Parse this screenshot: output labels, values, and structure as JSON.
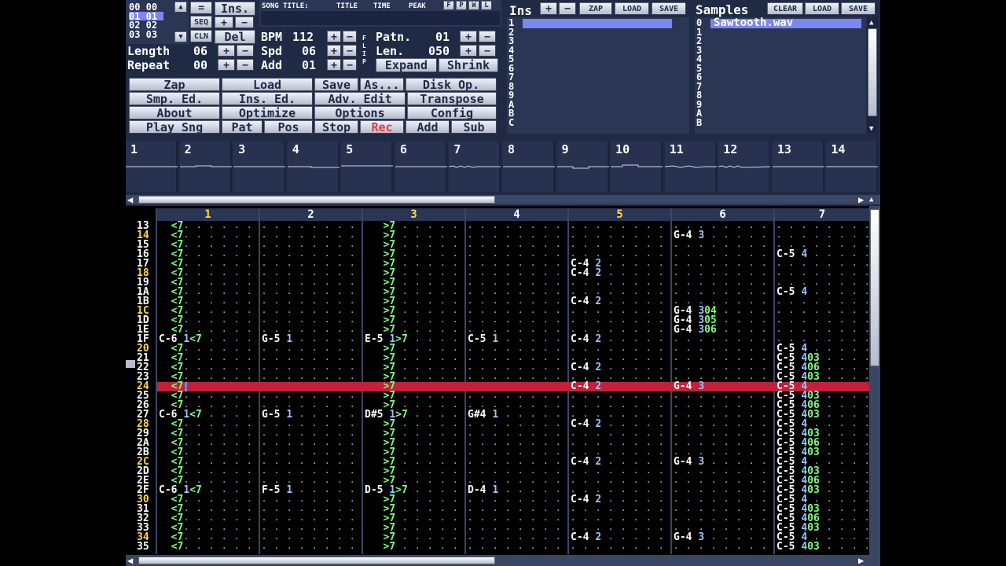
{
  "song": {
    "positions": [
      "00 00",
      "01 01",
      "02 02",
      "03 03"
    ],
    "length_label": "Length",
    "length": "06",
    "repeat_label": "Repeat",
    "repeat": "00"
  },
  "small_buttons": {
    "eq": "=",
    "seq": "SEQ",
    "cln": "CLN",
    "ins": "Ins.",
    "del": "Del",
    "plus": "+",
    "minus": "−"
  },
  "tempo": {
    "bpm_label": "BPM",
    "bpm": "112",
    "spd_label": "Spd",
    "spd": "06",
    "add_label": "Add",
    "add": "01",
    "flip": "FLIP"
  },
  "pattern_info": {
    "patn_label": "Patn.",
    "patn": "01",
    "len_label": "Len.",
    "len": "050",
    "expand": "Expand",
    "shrink": "Shrink"
  },
  "song_title": {
    "label": "SONG TITLE:",
    "title": "TITLE",
    "time": "TIME",
    "peak": "PEAK",
    "f": "F",
    "p": "P",
    "w": "W",
    "l": "L"
  },
  "menu": [
    [
      "Zap",
      "Load",
      "Save",
      "As...",
      "Disk Op."
    ],
    [
      "Smp. Ed.",
      "Ins. Ed.",
      "Adv. Edit",
      "Transpose"
    ],
    [
      "About",
      "Optimize",
      "Options",
      "Config"
    ],
    [
      "Play Sng",
      "Pat",
      "Pos",
      "Stop",
      "Rec",
      "Add",
      "Sub"
    ]
  ],
  "instruments": {
    "title": "Ins",
    "zap": "ZAP",
    "load": "LOAD",
    "save": "SAVE",
    "plus": "+",
    "minus": "−",
    "rows": [
      "1",
      "2",
      "3",
      "4",
      "5",
      "6",
      "7",
      "8",
      "9",
      "A",
      "B",
      "C"
    ]
  },
  "samples": {
    "title": "Samples",
    "clear": "CLEAR",
    "load": "LOAD",
    "save": "SAVE",
    "selected": "Sawtooth.wav",
    "rows": [
      "0",
      "1",
      "2",
      "3",
      "4",
      "5",
      "6",
      "7",
      "8",
      "9",
      "A",
      "B"
    ]
  },
  "scopes": [
    "1",
    "2",
    "3",
    "4",
    "5",
    "6",
    "7",
    "8",
    "9",
    "10",
    "11",
    "12",
    "13",
    "14"
  ],
  "channels": [
    "1",
    "2",
    "3",
    "4",
    "5",
    "6",
    "7"
  ],
  "active_channels": [
    "1",
    "3",
    "5"
  ],
  "rows": [
    {
      "n": "13",
      "c": [
        "  <7",
        "",
        "   >7",
        "",
        "",
        "",
        "",
        ""
      ]
    },
    {
      "n": "14",
      "hi": true,
      "c": [
        "  <7",
        "",
        "   >7",
        "",
        "",
        "G-4 3",
        "",
        ""
      ]
    },
    {
      "n": "15",
      "c": [
        "  <7",
        "",
        "   >7",
        "",
        "",
        "",
        "",
        ""
      ]
    },
    {
      "n": "16",
      "c": [
        "  <7",
        "",
        "   >7",
        "",
        "",
        "",
        "C-5 4",
        ""
      ]
    },
    {
      "n": "17",
      "c": [
        "  <7",
        "",
        "   >7",
        "",
        "C-4 2",
        "",
        "",
        ""
      ]
    },
    {
      "n": "18",
      "hi": true,
      "c": [
        "  <7",
        "",
        "   >7",
        "",
        "C-4 2",
        "",
        "",
        ""
      ]
    },
    {
      "n": "19",
      "c": [
        "  <7",
        "",
        "   >7",
        "",
        "",
        "",
        "",
        ""
      ]
    },
    {
      "n": "1A",
      "c": [
        "  <7",
        "",
        "   >7",
        "",
        "",
        "",
        "C-5 4",
        ""
      ]
    },
    {
      "n": "1B",
      "c": [
        "  <7",
        "",
        "   >7",
        "",
        "C-4 2",
        "",
        "",
        ""
      ]
    },
    {
      "n": "1C",
      "hi": true,
      "c": [
        "  <7",
        "",
        "   >7",
        "",
        "",
        "G-4 304",
        "",
        ""
      ]
    },
    {
      "n": "1D",
      "c": [
        "  <7",
        "",
        "   >7",
        "",
        "",
        "G-4 305",
        "",
        ""
      ]
    },
    {
      "n": "1E",
      "c": [
        "  <7",
        "",
        "   >7",
        "",
        "",
        "G-4 306",
        "",
        ""
      ]
    },
    {
      "n": "1F",
      "c": [
        "C-6 1<7",
        "G-5 1",
        "E-5 1>7",
        "C-5 1",
        "C-4 2",
        "",
        "",
        ""
      ]
    },
    {
      "n": "20",
      "hi": true,
      "c": [
        "  <7",
        "",
        "   >7",
        "",
        "",
        "",
        "C-5 4",
        ""
      ]
    },
    {
      "n": "21",
      "c": [
        "  <7",
        "",
        "   >7",
        "",
        "",
        "",
        "C-5 403",
        ""
      ]
    },
    {
      "n": "22",
      "c": [
        "  <7",
        "",
        "   >7",
        "",
        "C-4 2",
        "",
        "C-5 406",
        ""
      ]
    },
    {
      "n": "23",
      "c": [
        "  <7",
        "",
        "   >7",
        "",
        "",
        "",
        "C-5 403",
        ""
      ]
    },
    {
      "n": "24",
      "hi": true,
      "cur": true,
      "c": [
        "  <7",
        "",
        "   >7",
        "",
        "C-4 2",
        "G-4 3",
        "C-5 4",
        ""
      ]
    },
    {
      "n": "25",
      "c": [
        "  <7",
        "",
        "   >7",
        "",
        "",
        "",
        "C-5 403",
        ""
      ]
    },
    {
      "n": "26",
      "c": [
        "  <7",
        "",
        "   >7",
        "",
        "",
        "",
        "C-5 406",
        ""
      ]
    },
    {
      "n": "27",
      "c": [
        "C-6 1<7",
        "G-5 1",
        "D#5 1>7",
        "G#4 1",
        "",
        "",
        "C-5 403",
        ""
      ]
    },
    {
      "n": "28",
      "hi": true,
      "c": [
        "  <7",
        "",
        "   >7",
        "",
        "C-4 2",
        "",
        "C-5 4",
        ""
      ]
    },
    {
      "n": "29",
      "c": [
        "  <7",
        "",
        "   >7",
        "",
        "",
        "",
        "C-5 403",
        ""
      ]
    },
    {
      "n": "2A",
      "c": [
        "  <7",
        "",
        "   >7",
        "",
        "",
        "",
        "C-5 406",
        ""
      ]
    },
    {
      "n": "2B",
      "c": [
        "  <7",
        "",
        "   >7",
        "",
        "",
        "",
        "C-5 403",
        ""
      ]
    },
    {
      "n": "2C",
      "hi": true,
      "c": [
        "  <7",
        "",
        "   >7",
        "",
        "C-4 2",
        "G-4 3",
        "C-5 4",
        ""
      ]
    },
    {
      "n": "2D",
      "c": [
        "  <7",
        "",
        "   >7",
        "",
        "",
        "",
        "C-5 403",
        ""
      ]
    },
    {
      "n": "2E",
      "c": [
        "  <7",
        "",
        "   >7",
        "",
        "",
        "",
        "C-5 406",
        ""
      ]
    },
    {
      "n": "2F",
      "c": [
        "C-6 1<7",
        "F-5 1",
        "D-5 1>7",
        "D-4 1",
        "",
        "",
        "C-5 403",
        ""
      ]
    },
    {
      "n": "30",
      "hi": true,
      "c": [
        "  <7",
        "",
        "   >7",
        "",
        "C-4 2",
        "",
        "C-5 4",
        ""
      ]
    },
    {
      "n": "31",
      "c": [
        "  <7",
        "",
        "   >7",
        "",
        "",
        "",
        "C-5 403",
        ""
      ]
    },
    {
      "n": "32",
      "c": [
        "  <7",
        "",
        "   >7",
        "",
        "",
        "",
        "C-5 406",
        ""
      ]
    },
    {
      "n": "33",
      "c": [
        "  <7",
        "",
        "   >7",
        "",
        "",
        "",
        "C-5 403",
        ""
      ]
    },
    {
      "n": "34",
      "hi": true,
      "c": [
        "  <7",
        "",
        "   >7",
        "",
        "C-4 2",
        "G-4 3",
        "C-5 4",
        ""
      ]
    },
    {
      "n": "35",
      "c": [
        "  <7",
        "",
        "   >7",
        "",
        "",
        "",
        "C-5 403",
        ""
      ]
    }
  ],
  "colors": {
    "bg": "#1f2a45",
    "panel": "#2b3654",
    "cursor_row": "#c3203a",
    "highlight": "#ffd94a",
    "selection": "#7b87f0"
  }
}
